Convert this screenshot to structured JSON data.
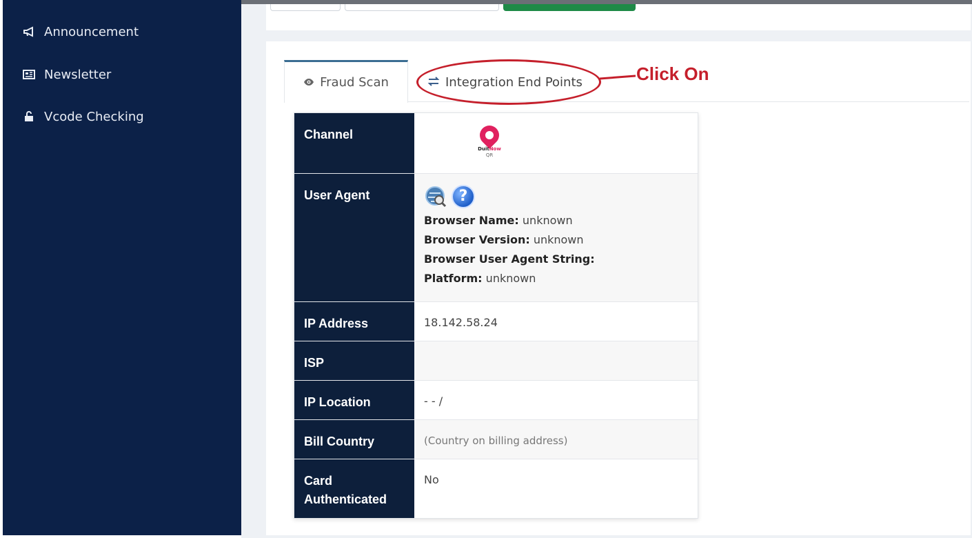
{
  "sidebar": {
    "items": [
      {
        "label": "Announcement",
        "icon": "megaphone-icon"
      },
      {
        "label": "Newsletter",
        "icon": "newspaper-icon"
      },
      {
        "label": "Vcode Checking",
        "icon": "unlock-icon"
      }
    ]
  },
  "tabs": [
    {
      "label": "Fraud Scan",
      "icon": "eye-icon",
      "active": true
    },
    {
      "label": "Integration End Points",
      "icon": "exchange-icon",
      "active": false
    }
  ],
  "annotation": {
    "text": "Click On",
    "color": "#c51f2b"
  },
  "fraud_table": {
    "channel": {
      "label": "Channel",
      "logo_text_1": "Duit",
      "logo_text_2": "Now",
      "logo_text_3": "QR"
    },
    "user_agent": {
      "label": "User Agent",
      "browser_name_label": "Browser Name:",
      "browser_name": "unknown",
      "browser_version_label": "Browser Version:",
      "browser_version": "unknown",
      "ua_string_label": "Browser User Agent String:",
      "platform_label": "Platform:",
      "platform": "unknown",
      "help_icon_text": "?"
    },
    "ip_address": {
      "label": "IP Address",
      "value": "18.142.58.24"
    },
    "isp": {
      "label": "ISP",
      "value": ""
    },
    "ip_location": {
      "label": "IP Location",
      "value": "- - /"
    },
    "bill_country": {
      "label": "Bill Country",
      "value": "(Country on billing address)"
    },
    "card_authenticated": {
      "label": "Card Authenticated",
      "value": "No"
    }
  },
  "colors": {
    "sidebar_bg": "#0c2148",
    "table_header_bg": "#0d1f3b",
    "annotation_red": "#c51f2b",
    "accent_green": "#1e8a47"
  }
}
